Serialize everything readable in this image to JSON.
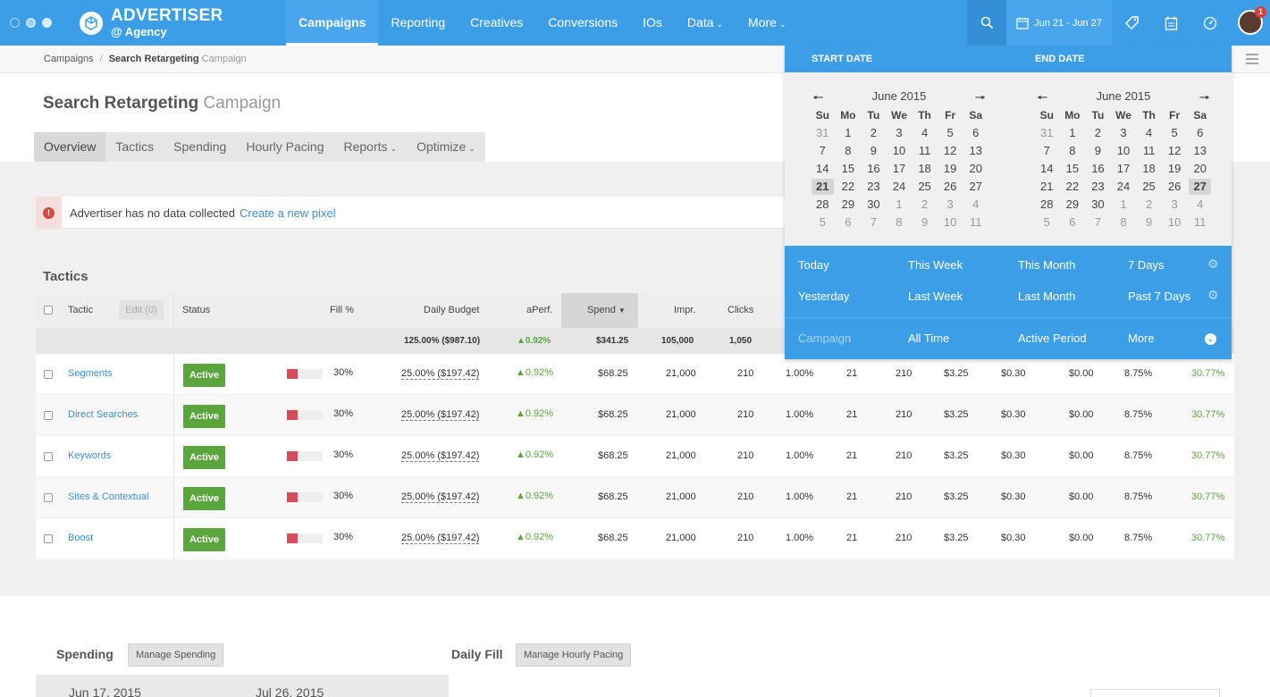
{
  "topbar": {
    "brand": "ADVERTISER",
    "brand_sub": "@ Agency",
    "nav": [
      "Campaigns",
      "Reporting",
      "Creatives",
      "Conversions",
      "IOs",
      "Data",
      "More"
    ],
    "date_range": "Jun 21 - Jun 27",
    "notification_count": "1",
    "accent": "#3d9ee8"
  },
  "breadcrumb": {
    "root": "Campaigns",
    "current": "Search Retargeting",
    "current_suffix": "Campaign"
  },
  "page": {
    "title": "Search Retargeting",
    "title_suffix": "Campaign",
    "tabs": [
      "Overview",
      "Tactics",
      "Spending",
      "Hourly Pacing",
      "Reports",
      "Optimize"
    ]
  },
  "alert": {
    "message": "Advertiser has no data collected",
    "link": "Create a new pixel",
    "color": "#d74848"
  },
  "tactics": {
    "title": "Tactics",
    "edit_label": "Edit (0)",
    "headers": [
      "Tactic",
      "Status",
      "Fill %",
      "Daily Budget",
      "aPerf.",
      "Spend",
      "Impr.",
      "Clicks"
    ],
    "summary": {
      "daily_budget": "125.00% ($987.10)",
      "aperf": "▲0.92%",
      "spend": "$341.25",
      "impr": "105,000",
      "clicks": "1,050"
    },
    "rows": [
      {
        "name": "Segments",
        "status": "Active",
        "fill_pct": "30%",
        "fill": 0.3,
        "daily_budget": "25.00% ($197.42)",
        "aperf": "▲0.92%",
        "spend": "$68.25",
        "impr": "21,000",
        "clicks": "210",
        "c1": "1.00%",
        "c2": "21",
        "c3": "210",
        "c4": "$3.25",
        "c5": "$0.30",
        "c6": "$0.00",
        "c7": "8.75%",
        "c8": "30.77%"
      },
      {
        "name": "Direct Searches",
        "status": "Active",
        "fill_pct": "30%",
        "fill": 0.3,
        "daily_budget": "25.00% ($197.42)",
        "aperf": "▲0.92%",
        "spend": "$68.25",
        "impr": "21,000",
        "clicks": "210",
        "c1": "1.00%",
        "c2": "21",
        "c3": "210",
        "c4": "$3.25",
        "c5": "$0.30",
        "c6": "$0.00",
        "c7": "8.75%",
        "c8": "30.77%"
      },
      {
        "name": "Keywords",
        "status": "Active",
        "fill_pct": "30%",
        "fill": 0.3,
        "daily_budget": "25.00% ($197.42)",
        "aperf": "▲0.92%",
        "spend": "$68.25",
        "impr": "21,000",
        "clicks": "210",
        "c1": "1.00%",
        "c2": "21",
        "c3": "210",
        "c4": "$3.25",
        "c5": "$0.30",
        "c6": "$0.00",
        "c7": "8.75%",
        "c8": "30.77%"
      },
      {
        "name": "Sites & Contextual",
        "status": "Active",
        "fill_pct": "30%",
        "fill": 0.3,
        "daily_budget": "25.00% ($197.42)",
        "aperf": "▲0.92%",
        "spend": "$68.25",
        "impr": "21,000",
        "clicks": "210",
        "c1": "1.00%",
        "c2": "21",
        "c3": "210",
        "c4": "$3.25",
        "c5": "$0.30",
        "c6": "$0.00",
        "c7": "8.75%",
        "c8": "30.77%"
      },
      {
        "name": "Boost",
        "status": "Active",
        "fill_pct": "30%",
        "fill": 0.3,
        "daily_budget": "25.00% ($197.42)",
        "aperf": "▲0.92%",
        "spend": "$68.25",
        "impr": "21,000",
        "clicks": "210",
        "c1": "1.00%",
        "c2": "21",
        "c3": "210",
        "c4": "$3.25",
        "c5": "$0.30",
        "c6": "$0.00",
        "c7": "8.75%",
        "c8": "30.77%"
      }
    ]
  },
  "bottom": {
    "spending_title": "Spending",
    "manage_spending": "Manage Spending",
    "daily_fill_title": "Daily Fill",
    "manage_pacing": "Manage Hourly Pacing",
    "date_start": "Jun 17, 2015",
    "date_end": "Jul 26, 2015"
  },
  "datepicker": {
    "start_label": "START DATE",
    "end_label": "END DATE",
    "calendars": [
      {
        "month": "June 2015",
        "dow": [
          "Su",
          "Mo",
          "Tu",
          "We",
          "Th",
          "Fr",
          "Sa"
        ],
        "days": [
          "31",
          "1",
          "2",
          "3",
          "4",
          "5",
          "6",
          "7",
          "8",
          "9",
          "10",
          "11",
          "12",
          "13",
          "14",
          "15",
          "16",
          "17",
          "18",
          "19",
          "20",
          "21",
          "22",
          "23",
          "24",
          "25",
          "26",
          "27",
          "28",
          "29",
          "30",
          "1",
          "2",
          "3",
          "4",
          "5",
          "6",
          "7",
          "8",
          "9",
          "10",
          "11"
        ],
        "selected": "21"
      },
      {
        "month": "June 2015",
        "dow": [
          "Su",
          "Mo",
          "Tu",
          "We",
          "Th",
          "Fr",
          "Sa"
        ],
        "days": [
          "31",
          "1",
          "2",
          "3",
          "4",
          "5",
          "6",
          "7",
          "8",
          "9",
          "10",
          "11",
          "12",
          "13",
          "14",
          "15",
          "16",
          "17",
          "18",
          "19",
          "20",
          "21",
          "22",
          "23",
          "24",
          "25",
          "26",
          "27",
          "28",
          "29",
          "30",
          "1",
          "2",
          "3",
          "4",
          "5",
          "6",
          "7",
          "8",
          "9",
          "10",
          "11"
        ],
        "selected": "27"
      }
    ],
    "presets_row1": [
      "Today",
      "This Week",
      "This Month",
      "7 Days"
    ],
    "presets_row2": [
      "Yesterday",
      "Last Week",
      "Last Month",
      "Past 7 Days"
    ],
    "footer": [
      "Campaign",
      "All Time",
      "Active Period",
      "More"
    ]
  }
}
